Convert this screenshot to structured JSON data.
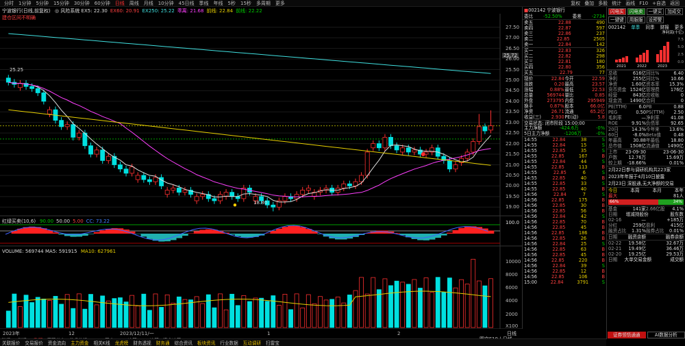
{
  "topbar": {
    "periods": [
      "分时",
      "1分钟",
      "5分钟",
      "15分钟",
      "30分钟",
      "60分钟",
      "日线",
      "周线",
      "月线",
      "10分钟",
      "45日线",
      "季线",
      "年线",
      "5秒",
      "15秒",
      "多周期",
      "更多"
    ],
    "active": "日线",
    "tools": [
      "复权",
      "叠加",
      "多股",
      "统计",
      "画线",
      "F10",
      "+自选",
      "返回"
    ]
  },
  "chart": {
    "title": "宁波银行(日线,前复权)",
    "ma_legend": [
      {
        "t": "◎ 风险系统 EX5: 22.30",
        "c": "#ddd"
      },
      {
        "t": "EX60: 20.91",
        "c": "#ff4040"
      },
      {
        "t": "EX250: 25.22",
        "c": "#40e0e0"
      },
      {
        "t": "乖离: 21.68",
        "c": "#ff40ff"
      },
      {
        "t": "前线: 22.84",
        "c": "#e8d000"
      },
      {
        "t": "前线: 22.22",
        "c": "#00d000"
      }
    ],
    "sub_title": "建仓区间不明确",
    "price_axis": [
      "27.50",
      "27.00",
      "26.50",
      "26.00",
      "25.50",
      "25.00",
      "24.50",
      "24.00",
      "23.50",
      "23.00",
      "22.50",
      "22.00",
      "21.50",
      "21.00",
      "20.50",
      "20.00",
      "19.50",
      "19.00"
    ],
    "price_tag": "25.72",
    "high_label": "25.25",
    "low_label": "18.80",
    "ind_title": "红绿买卖(10,6)",
    "ind_vals": [
      {
        "t": "90.00",
        "c": "#00d000"
      },
      {
        "t": "50.00",
        "c": "#ddd"
      },
      {
        "t": "5.00",
        "c": "#ff4040"
      },
      {
        "t": "CC: 73.22",
        "c": "#4080ff"
      }
    ],
    "ind_axis": "100.0",
    "vol_title": "VOLUME: 569744",
    "vol_ma5": "MA5: 591915",
    "vol_ma10": "MA10: 627961",
    "vol_axis": [
      "10000",
      "8000",
      "6000",
      "4000",
      "2000",
      "X100"
    ],
    "date_axis": [
      "2023年",
      "12",
      "2023/12/11/一",
      "1",
      "2"
    ],
    "date_right": "日线"
  },
  "quote": {
    "code": "002142",
    "name": "宁波银行",
    "webi_l": "委比",
    "webi_v": "-52.50%",
    "weicha_l": "委差",
    "weicha_v": "-2734",
    "asks": [
      {
        "n": "卖五",
        "p": "22.88",
        "v": "490"
      },
      {
        "n": "卖四",
        "p": "22.87",
        "v": "597"
      },
      {
        "n": "卖三",
        "p": "22.86",
        "v": "237"
      },
      {
        "n": "卖二",
        "p": "22.85",
        "v": "2505"
      },
      {
        "n": "卖一",
        "p": "22.84",
        "v": "142"
      }
    ],
    "bids": [
      {
        "n": "买一",
        "p": "22.83",
        "v": "326"
      },
      {
        "n": "买二",
        "p": "22.82",
        "v": "298"
      },
      {
        "n": "买三",
        "p": "22.81",
        "v": "180"
      },
      {
        "n": "买四",
        "p": "22.80",
        "v": "356"
      },
      {
        "n": "买五",
        "p": "22.79",
        "v": "77"
      }
    ],
    "stats": [
      [
        "现价",
        "22.84",
        "今开",
        "22.59"
      ],
      [
        "涨跌",
        "0.20",
        "最高",
        "23.57"
      ],
      [
        "涨幅",
        "0.88%",
        "最低",
        "22.53"
      ],
      [
        "总量",
        "569744",
        "量比",
        "0.85"
      ],
      [
        "外盘",
        "273795",
        "内盘",
        "295949"
      ],
      [
        "换手",
        "0.87%",
        "股本",
        "66.0亿"
      ],
      [
        "净资",
        "26.71",
        "流通",
        "65.2亿"
      ],
      [
        "收益(三)",
        "2.930",
        "PE(动)",
        "5.8"
      ]
    ],
    "phase": "交易状态: 闭市阶段 15:00:00",
    "flows": [
      {
        "n": "主力净额",
        "v": "-424.6万",
        "p": "-0%"
      },
      {
        "n": "5日主力净额",
        "v": "-1206万",
        "p": "-0%"
      }
    ],
    "ticks": [
      [
        "14:55",
        "22.84",
        "38",
        "S"
      ],
      [
        "14:55",
        "22.84",
        "15",
        "S"
      ],
      [
        "14:55",
        "22.85",
        "35",
        "S"
      ],
      [
        "14:55",
        "22.85",
        "167",
        "B"
      ],
      [
        "14:55",
        "22.84",
        "44",
        "S"
      ],
      [
        "14:55",
        "22.85",
        "113",
        "B"
      ],
      [
        "14:55",
        "22.85",
        "6",
        "S"
      ],
      [
        "14:55",
        "22.85",
        "40",
        "B"
      ],
      [
        "14:55",
        "22.85",
        "33",
        "S"
      ],
      [
        "14:55",
        "22.85",
        "40",
        "B"
      ],
      [
        "14:56",
        "22.84",
        "7",
        "S"
      ],
      [
        "14:56",
        "22.85",
        "175",
        "B"
      ],
      [
        "14:56",
        "22.85",
        "30",
        "B"
      ],
      [
        "14:56",
        "22.85",
        "56",
        "B"
      ],
      [
        "14:56",
        "22.84",
        "42",
        "S"
      ],
      [
        "14:56",
        "22.85",
        "70",
        "B"
      ],
      [
        "14:56",
        "22.85",
        "45",
        "B"
      ],
      [
        "14:56",
        "22.85",
        "186",
        "B"
      ],
      [
        "14:56",
        "22.85",
        "26",
        "B"
      ],
      [
        "14:56",
        "22.84",
        "25",
        "S"
      ],
      [
        "14:56",
        "22.85",
        "63",
        "B"
      ],
      [
        "14:56",
        "22.85",
        "45",
        "B"
      ],
      [
        "14:56",
        "22.85",
        "220",
        "B"
      ],
      [
        "14:56",
        "22.84",
        "39",
        "S"
      ],
      [
        "14:56",
        "22.85",
        "12",
        "B"
      ],
      [
        "14:56",
        "22.85",
        "106",
        "B"
      ],
      [
        "15:00",
        "22.84",
        "3791",
        "S"
      ]
    ]
  },
  "info": {
    "tags": [
      "闪电买",
      "闪电卖",
      "一键买",
      "加成交"
    ],
    "tags2": [
      "一键键",
      "用服服",
      "设预警"
    ],
    "code": "002142",
    "tabs": [
      "单季",
      "同季",
      "财报",
      "更多"
    ],
    "chart_t": "净利润(十亿)",
    "years": [
      "2021",
      "2022",
      "2023"
    ],
    "bars": [
      0.6,
      1.2,
      2.0
    ],
    "bar_axis": [
      "7.5",
      "5.0",
      "2.5",
      "0.0"
    ],
    "kv": [
      [
        "总收",
        "616亿",
        "同比%",
        "6.40"
      ],
      [
        "净利",
        "255亿",
        "同比%",
        "10.66"
      ],
      [
        "净资",
        "1.60亿",
        "资本率",
        "15.3%"
      ],
      [
        "货币资金",
        "1524亿",
        "管理费",
        "176亿"
      ],
      [
        "经营",
        "843亿",
        "应收账",
        "0"
      ],
      [
        "现金流",
        "1490亿",
        "合同",
        "0"
      ]
    ],
    "val": [
      [
        "PE(TTM)",
        "6.0",
        "PB",
        "0.88"
      ],
      [
        "PEG",
        "0.50",
        "PS(TTM)",
        "2.50"
      ],
      [
        "毛利率",
        "—",
        "净利率",
        "41.08"
      ],
      [
        "ROE",
        "9.91%",
        "负债率",
        "92.65"
      ]
    ],
    "perf": [
      [
        "20日",
        "14.3%",
        "今年来",
        "13.6%"
      ],
      [
        "60日",
        "-8.0%",
        "Beta值",
        "0.48"
      ],
      [
        "年最高",
        "30.88",
        "年最低",
        "18.80"
      ],
      [
        "总市值",
        "1508亿",
        "流通值",
        "1490亿"
      ]
    ],
    "ipo": [
      [
        "上市",
        "23-09-30",
        "",
        "23-06-30"
      ],
      [
        "户数",
        "12.76万",
        "",
        "15.69万"
      ],
      [
        "较上期",
        "-18.66%",
        "",
        "0.01%"
      ]
    ],
    "news": [
      "2月22日参与调研机构共223家",
      "2023年年报于4月10日披露",
      "2月23日 深股通,无大净额的交易"
    ],
    "sentiment": {
      "l": "最大",
      "lv": "66%",
      "r": "34%",
      "rv": "81人",
      "t": [
        "今日",
        "本周",
        "本月",
        "本年"
      ]
    },
    "fund": [
      [
        "基金",
        "141家",
        "2.66亿股",
        "4.1%"
      ],
      [
        "日期",
        "增减持股份",
        "",
        "股东数"
      ],
      [
        "02-16",
        "—",
        "",
        "+185万"
      ],
      [
        "分红",
        "259亿",
        "盈利",
        "415亿"
      ],
      [
        "融资占比",
        "1.31%",
        "融券占比",
        "0.01%"
      ]
    ],
    "margin_h": [
      "日期",
      "融资余额",
      "",
      "融券余额"
    ],
    "margin": [
      [
        "02-22",
        "19.58亿",
        "",
        "32.67万"
      ],
      [
        "02-21",
        "19.49亿",
        "",
        "36.46万"
      ],
      [
        "02-20",
        "19.25亿",
        "",
        "29.53万"
      ],
      [
        "日期",
        "大单交易金额",
        "",
        "成交额"
      ]
    ],
    "footer": [
      "证券领悟通通",
      "AI数据分析"
    ]
  },
  "bottombar": [
    "关联报价",
    "交易报价",
    "资金流向",
    "主力资金",
    "相关K线",
    "龙虎榜",
    "财务透视",
    "财务通",
    "综合资讯",
    "板块资讯",
    "行业数据",
    "互动调研",
    "扫雷宝"
  ],
  "bottom_left": [
    "指标A",
    "指标B",
    "整理",
    "筹码分布",
    "龙虎分析",
    "MACD基本",
    "DDE决策",
    "SUP决策",
    "资金决策"
  ],
  "bottom_right": "图文F10 | 日线"
}
